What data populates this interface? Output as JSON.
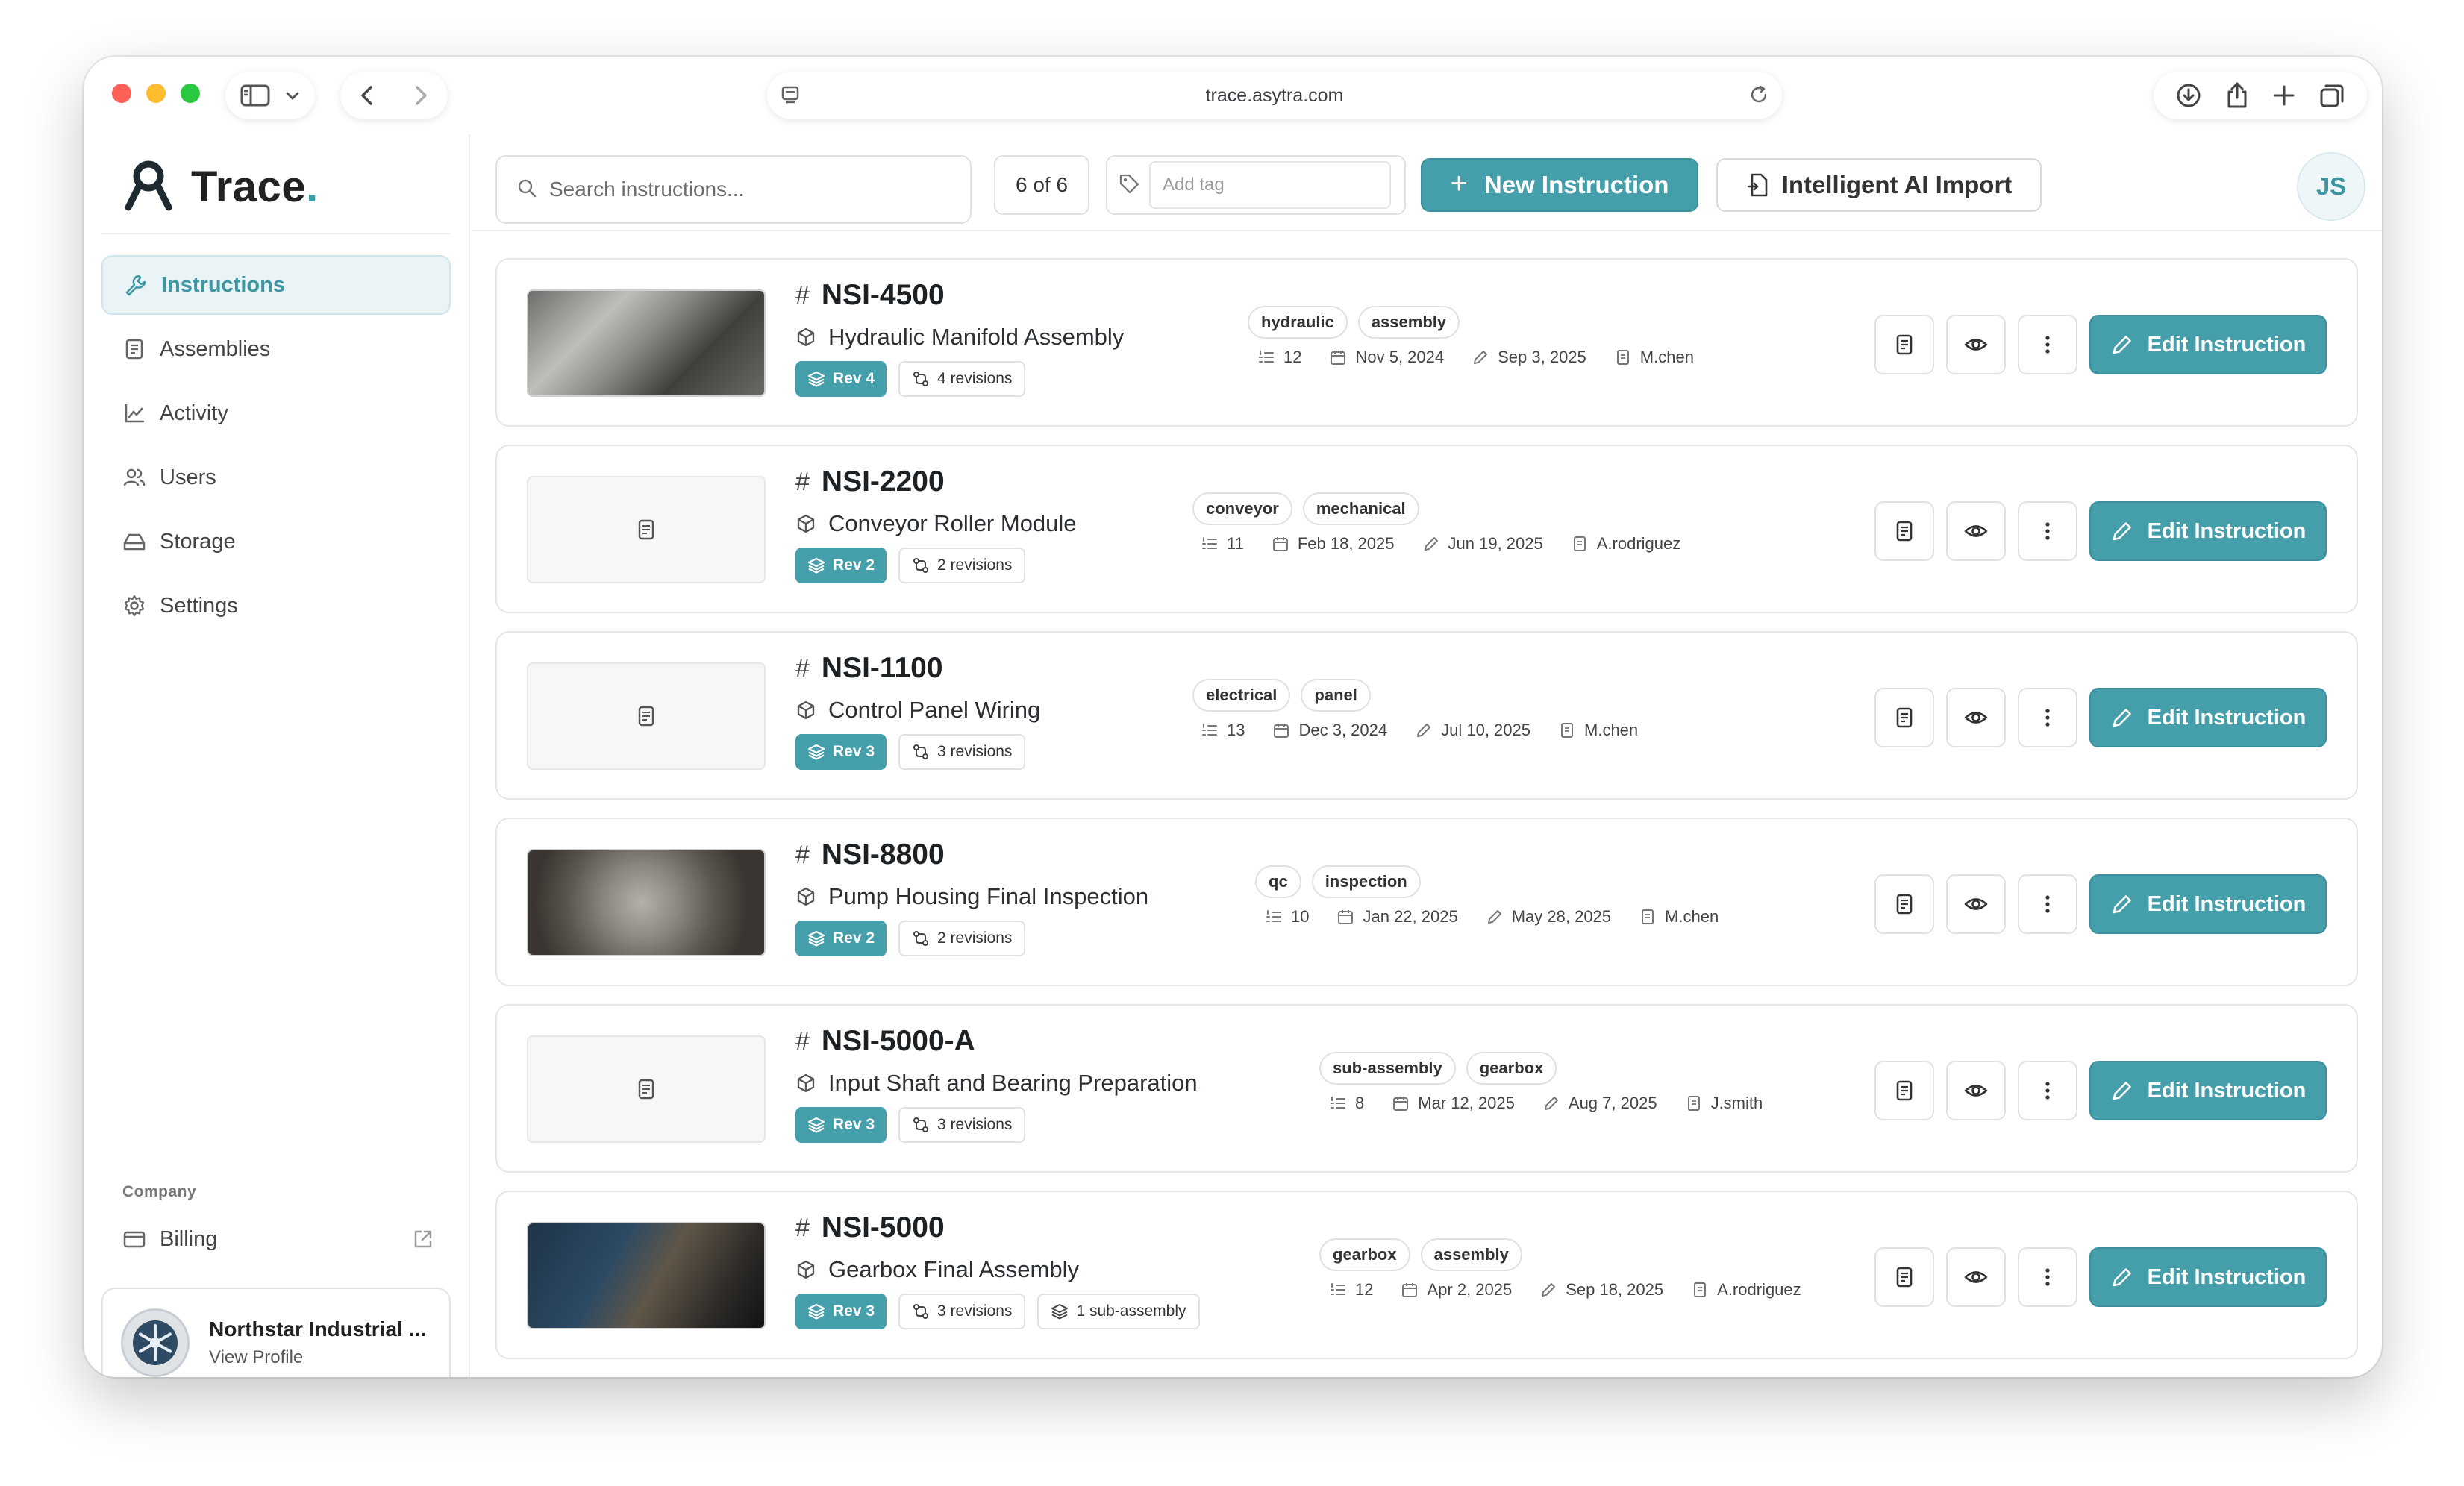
{
  "browser": {
    "url": "trace.asytra.com"
  },
  "sidebar": {
    "brand": "Trace",
    "brand_dot": ".",
    "nav": [
      {
        "label": "Instructions",
        "icon": "wrench-icon",
        "active": true
      },
      {
        "label": "Assemblies",
        "icon": "blueprint-icon",
        "active": false
      },
      {
        "label": "Activity",
        "icon": "chart-line-icon",
        "active": false
      },
      {
        "label": "Users",
        "icon": "users-icon",
        "active": false
      },
      {
        "label": "Storage",
        "icon": "drive-icon",
        "active": false
      },
      {
        "label": "Settings",
        "icon": "gear-icon",
        "active": false
      }
    ],
    "section_label": "Company",
    "billing_label": "Billing",
    "profile_name": "Northstar Industrial ...",
    "profile_link": "View Profile"
  },
  "header": {
    "search_placeholder": "Search instructions...",
    "count": "6 of 6",
    "tag_placeholder": "Add tag",
    "new_button": "New Instruction",
    "new_button_plus": "+",
    "ai_button": "Intelligent AI Import",
    "user_initials": "JS"
  },
  "colors": {
    "accent": "#459fab",
    "active_bg": "#eaf4f6"
  },
  "instructions": [
    {
      "code": "NSI-4500",
      "title": "Hydraulic Manifold Assembly",
      "rev": "Rev 4",
      "revisions": "4 revisions",
      "subassembly": "",
      "tags": [
        "hydraulic",
        "assembly"
      ],
      "steps": "12",
      "created": "Nov 5, 2024",
      "updated": "Sep 3, 2025",
      "author": "M.chen",
      "thumb": "photo"
    },
    {
      "code": "NSI-2200",
      "title": "Conveyor Roller Module",
      "rev": "Rev 2",
      "revisions": "2 revisions",
      "subassembly": "",
      "tags": [
        "conveyor",
        "mechanical"
      ],
      "steps": "11",
      "created": "Feb 18, 2025",
      "updated": "Jun 19, 2025",
      "author": "A.rodriguez",
      "thumb": "placeholder"
    },
    {
      "code": "NSI-1100",
      "title": "Control Panel Wiring",
      "rev": "Rev 3",
      "revisions": "3 revisions",
      "subassembly": "",
      "tags": [
        "electrical",
        "panel"
      ],
      "steps": "13",
      "created": "Dec 3, 2024",
      "updated": "Jul 10, 2025",
      "author": "M.chen",
      "thumb": "placeholder"
    },
    {
      "code": "NSI-8800",
      "title": "Pump Housing Final Inspection",
      "rev": "Rev 2",
      "revisions": "2 revisions",
      "subassembly": "",
      "tags": [
        "qc",
        "inspection"
      ],
      "steps": "10",
      "created": "Jan 22, 2025",
      "updated": "May 28, 2025",
      "author": "M.chen",
      "thumb": "photo"
    },
    {
      "code": "NSI-5000-A",
      "title": "Input Shaft and Bearing Preparation",
      "rev": "Rev 3",
      "revisions": "3 revisions",
      "subassembly": "",
      "tags": [
        "sub-assembly",
        "gearbox"
      ],
      "steps": "8",
      "created": "Mar 12, 2025",
      "updated": "Aug 7, 2025",
      "author": "J.smith",
      "thumb": "placeholder"
    },
    {
      "code": "NSI-5000",
      "title": "Gearbox Final Assembly",
      "rev": "Rev 3",
      "revisions": "3 revisions",
      "subassembly": "1 sub-assembly",
      "tags": [
        "gearbox",
        "assembly"
      ],
      "steps": "12",
      "created": "Apr 2, 2025",
      "updated": "Sep 18, 2025",
      "author": "A.rodriguez",
      "thumb": "photo"
    }
  ],
  "card_actions": {
    "edit_label": "Edit Instruction",
    "hash": "#"
  }
}
